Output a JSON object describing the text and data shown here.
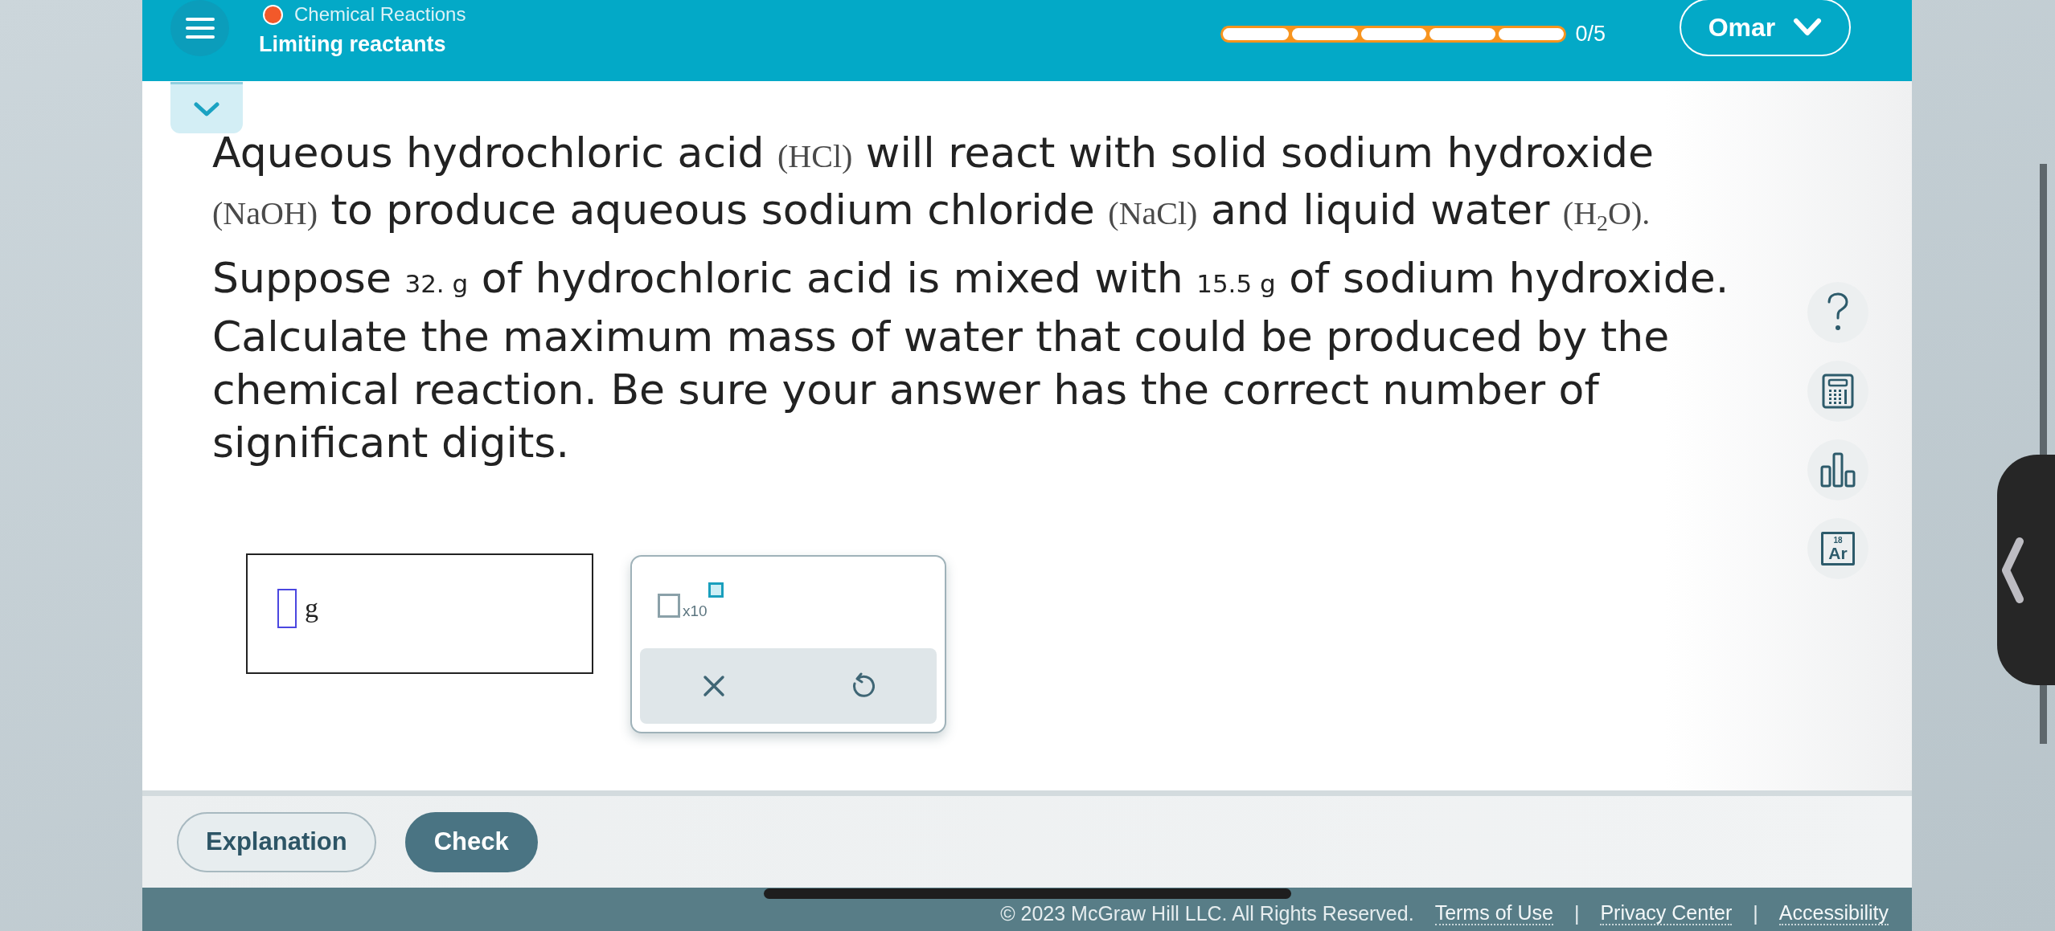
{
  "top_bar": {
    "topic": "Chemical Reactions",
    "title": "Limiting reactants",
    "progress": {
      "segments": [
        {
          "done": false
        },
        {
          "done": false
        },
        {
          "done": false
        },
        {
          "done": false
        },
        {
          "done": false
        }
      ],
      "reading": "0/5"
    },
    "user_menu": {
      "label": "Omar"
    }
  },
  "question": {
    "paragraphs": [
      [
        {
          "kind": "text",
          "text": "Aqueous hydrochloric acid "
        },
        {
          "kind": "formula",
          "text": "(HCl)"
        },
        {
          "kind": "text",
          "text": " will react with solid sodium hydroxide "
        },
        {
          "kind": "formula",
          "text": "(NaOH)"
        },
        {
          "kind": "text",
          "text": " to produce aqueous sodium chloride "
        },
        {
          "kind": "formula",
          "text": "(NaCl)"
        },
        {
          "kind": "text",
          "text": " and liquid water "
        },
        {
          "kind": "formula",
          "text": "(H$_{2}$O)."
        }
      ],
      [
        {
          "kind": "text",
          "text": "Suppose "
        },
        {
          "kind": "quantity",
          "text": "32. g"
        },
        {
          "kind": "text",
          "text": " of hydrochloric acid is mixed with "
        },
        {
          "kind": "quantity",
          "text": "15.5 g"
        },
        {
          "kind": "text",
          "text": " of sodium hydroxide. Calculate the maximum mass of water that could be produced by the chemical reaction. Be sure your answer has the correct number of significant digits."
        }
      ]
    ]
  },
  "answer": {
    "unit": "g"
  },
  "answer_tools": {
    "exponent_label": "x10"
  },
  "side_tools": [
    {
      "kind": "help"
    },
    {
      "kind": "calculator"
    },
    {
      "kind": "data"
    },
    {
      "kind": "periodic_table",
      "number": "18",
      "symbol": "Ar"
    }
  ],
  "actions": [
    {
      "label": "Explanation",
      "kind": "secondary"
    },
    {
      "label": "Check",
      "kind": "primary"
    }
  ],
  "footer": {
    "copyright": "© 2023 McGraw Hill LLC. All Rights Reserved.",
    "items": [
      {
        "kind": "link",
        "text": "Terms of Use"
      },
      {
        "kind": "separator",
        "text": "|"
      },
      {
        "kind": "link",
        "text": "Privacy Center"
      },
      {
        "kind": "separator",
        "text": "|"
      },
      {
        "kind": "link",
        "text": "Accessibility"
      }
    ]
  }
}
